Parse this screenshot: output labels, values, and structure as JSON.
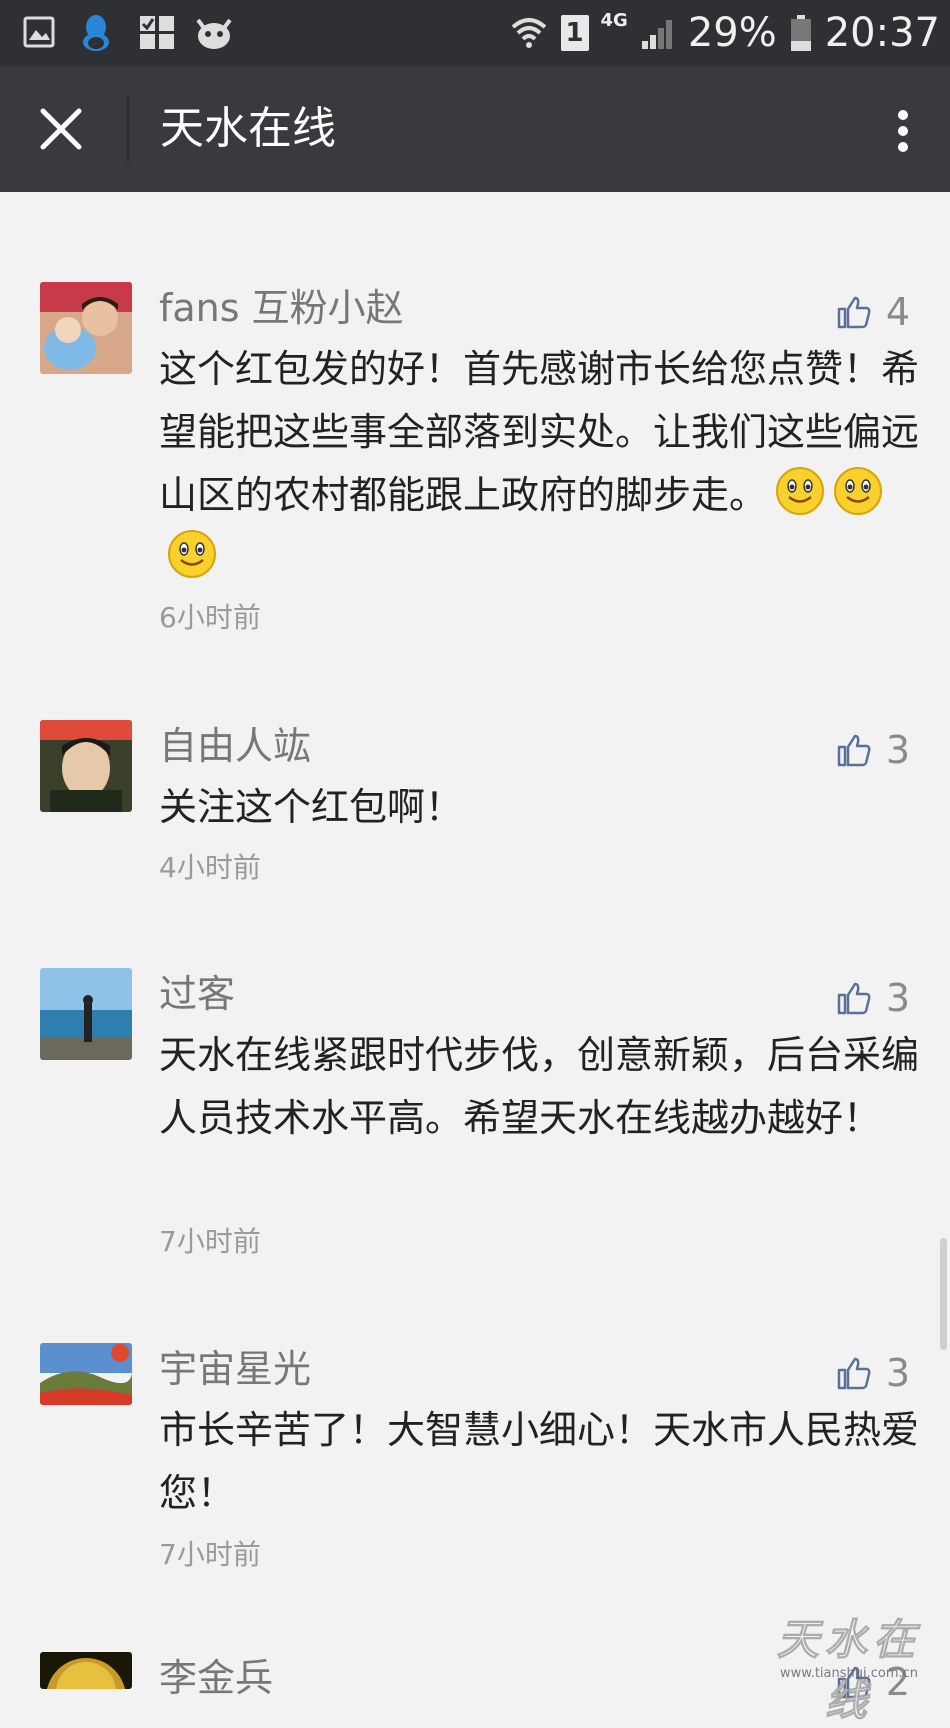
{
  "status_bar": {
    "battery_percent": "29%",
    "time": "20:37",
    "network": "4G",
    "sim_slot": "1",
    "icons": [
      "gallery-icon",
      "qq-icon",
      "sim-toolkit-icon",
      "cow-app-icon",
      "wifi-icon",
      "sim-icon",
      "signal-icon",
      "battery-icon"
    ]
  },
  "header": {
    "title": "天水在线",
    "close_icon": "close-icon",
    "more_icon": "more-vertical-icon"
  },
  "comments": [
    {
      "nickname": "fans 互粉小赵",
      "likes": "4",
      "content": "这个红包发的好！首先感谢市长给您点赞！希望能把这些事全部落到实处。让我们这些偏远山区的农村都能跟上政府的脚步走。",
      "emoji_count": 3,
      "time": "6小时前",
      "avatar_colors": [
        "#c73a4a",
        "#7fb9e6"
      ]
    },
    {
      "nickname": "自由人竑",
      "likes": "3",
      "content": "关注这个红包啊！",
      "time": "4小时前",
      "avatar_colors": [
        "#3a3f2a",
        "#e6c9a8"
      ]
    },
    {
      "nickname": "过客",
      "likes": "3",
      "content": "天水在线紧跟时代步伐，创意新颖，后台采编人员技术水平高。希望天水在线越办越好！",
      "time": "7小时前",
      "avatar_colors": [
        "#5fa6d6",
        "#2e7fb0"
      ]
    },
    {
      "nickname": "宇宙星光",
      "likes": "3",
      "content": "市长辛苦了！大智慧小细心！天水市人民热爱您！",
      "time": "7小时前",
      "avatar_colors": [
        "#5a8fd0",
        "#d83a2a"
      ]
    },
    {
      "nickname": "李金兵",
      "likes": "2",
      "content": "",
      "time": "",
      "avatar_colors": [
        "#8a6a1a",
        "#e8c040"
      ]
    }
  ],
  "watermark": {
    "text": "天水在线",
    "url": "www.tianshui.com.cn"
  },
  "colors": {
    "status_bar": "#2f3033",
    "title_bar": "#393a3f",
    "background": "#f2f2f2",
    "like_icon": "#5b6f9b",
    "nickname": "#777777",
    "content": "#222222"
  }
}
